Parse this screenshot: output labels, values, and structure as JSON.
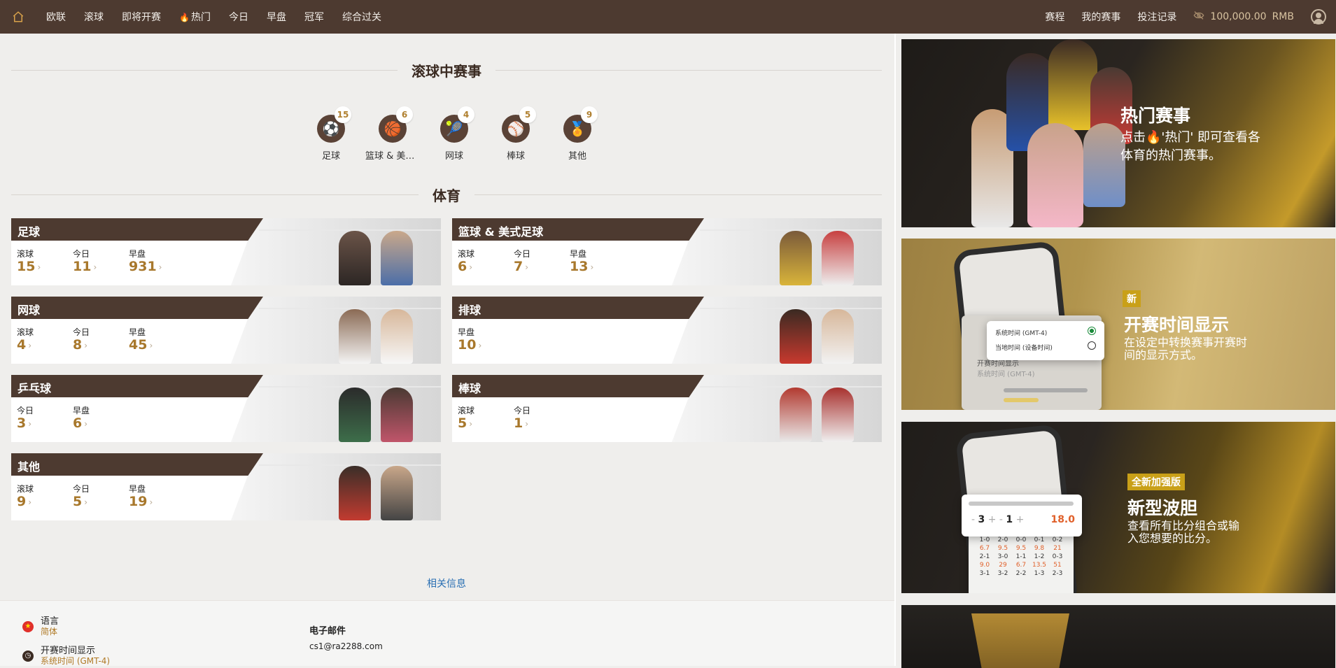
{
  "nav": {
    "items": [
      "欧联",
      "滚球",
      "即将开赛",
      "热门",
      "今日",
      "早盘",
      "冠军",
      "综合过关"
    ],
    "right": [
      "赛程",
      "我的赛事",
      "投注记录"
    ],
    "balance": "100,000.00",
    "currency": "RMB"
  },
  "live": {
    "title": "滚球中赛事",
    "items": [
      {
        "label": "足球",
        "count": "15",
        "icon": "soccer-ball-icon"
      },
      {
        "label": "篮球 & 美式足球",
        "count": "6",
        "icon": "basketball-icon"
      },
      {
        "label": "网球",
        "count": "4",
        "icon": "tennis-icon"
      },
      {
        "label": "棒球",
        "count": "5",
        "icon": "baseball-icon"
      },
      {
        "label": "其他",
        "count": "9",
        "icon": "medal-icon"
      }
    ]
  },
  "sports": {
    "title": "体育",
    "cards": [
      {
        "name": "足球",
        "stats": [
          {
            "label": "滚球",
            "value": "15"
          },
          {
            "label": "今日",
            "value": "11"
          },
          {
            "label": "早盘",
            "value": "931"
          }
        ]
      },
      {
        "name": "篮球 & 美式足球",
        "stats": [
          {
            "label": "滚球",
            "value": "6"
          },
          {
            "label": "今日",
            "value": "7"
          },
          {
            "label": "早盘",
            "value": "13"
          }
        ]
      },
      {
        "name": "网球",
        "stats": [
          {
            "label": "滚球",
            "value": "4"
          },
          {
            "label": "今日",
            "value": "8"
          },
          {
            "label": "早盘",
            "value": "45"
          }
        ]
      },
      {
        "name": "排球",
        "stats": [
          {
            "label": "早盘",
            "value": "10"
          }
        ]
      },
      {
        "name": "乒乓球",
        "stats": [
          {
            "label": "今日",
            "value": "3"
          },
          {
            "label": "早盘",
            "value": "6"
          }
        ]
      },
      {
        "name": "棒球",
        "stats": [
          {
            "label": "滚球",
            "value": "5"
          },
          {
            "label": "今日",
            "value": "1"
          }
        ]
      },
      {
        "name": "其他",
        "stats": [
          {
            "label": "滚球",
            "value": "9"
          },
          {
            "label": "今日",
            "value": "5"
          },
          {
            "label": "早盘",
            "value": "19"
          }
        ]
      }
    ]
  },
  "related_label": "相关信息",
  "footer": {
    "language_label": "语言",
    "language_value": "简体",
    "time_label": "开赛时间显示",
    "time_value": "系统时间 (GMT-4)",
    "email_title": "电子邮件",
    "email": "cs1@ra2288.com"
  },
  "banners": {
    "b1_title": "热门赛事",
    "b1_sub_1": "点击",
    "b1_sub_2": "'热门' 即可查看各",
    "b1_sub_3": "体育的热门赛事。",
    "b2_tag": "新",
    "b2_title": "开赛时间显示",
    "b2_sub": "在设定中转换赛事开赛时间的显示方式。",
    "b2_opt1": "系统时间 (GMT-4)",
    "b2_opt2": "当地时间 (设备时间)",
    "b2_row": "开赛时间显示",
    "b2_row_sub": "系统时间 (GMT-4)",
    "b3_tag": "全新加强版",
    "b3_title": "新型波胆",
    "b3_sub": "查看所有比分组合或输入您想要的比分。",
    "b3_score_a": "3",
    "b3_score_b": "1",
    "b3_odds": "18.0",
    "b3_grid": [
      [
        "1-0",
        "2-0",
        "0-0",
        "0-1",
        "0-2"
      ],
      [
        "6.7",
        "9.5",
        "9.5",
        "9.8",
        "21"
      ],
      [
        "2-1",
        "3-0",
        "1-1",
        "1-2",
        "0-3"
      ],
      [
        "9.0",
        "29",
        "6.7",
        "13.5",
        "51"
      ],
      [
        "3-1",
        "3-2",
        "2-2",
        "1-3",
        "2-3"
      ]
    ]
  },
  "colors": {
    "brand": "#4d3a30",
    "accent": "#a8782c",
    "link": "#2a6fb3"
  }
}
